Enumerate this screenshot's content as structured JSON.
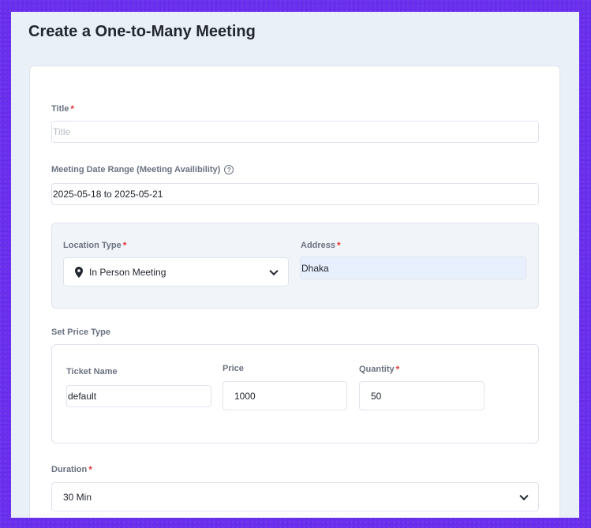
{
  "page": {
    "title": "Create a One-to-Many Meeting"
  },
  "form": {
    "title": {
      "label": "Title",
      "required": "*",
      "placeholder": "Title",
      "value": ""
    },
    "date_range": {
      "label": "Meeting Date Range (Meeting Availibility)",
      "help_icon": "?",
      "value": "2025-05-18 to 2025-05-21"
    },
    "location_type": {
      "label": "Location Type",
      "required": "*",
      "value": "In Person Meeting",
      "icon": "map-pin-icon"
    },
    "address": {
      "label": "Address",
      "required": "*",
      "value": "Dhaka"
    },
    "price_type": {
      "label": "Set Price Type"
    },
    "ticket": {
      "name_label": "Ticket Name",
      "name_value": "default",
      "price_label": "Price",
      "price_value": "1000",
      "quantity_label": "Quantity",
      "quantity_required": "*",
      "quantity_value": "50"
    },
    "duration": {
      "label": "Duration",
      "required": "*",
      "value": "30 Min"
    }
  },
  "colors": {
    "accent_required": "#e53935",
    "background": "#6a2ff0",
    "autofill": "#e8f0fe"
  }
}
